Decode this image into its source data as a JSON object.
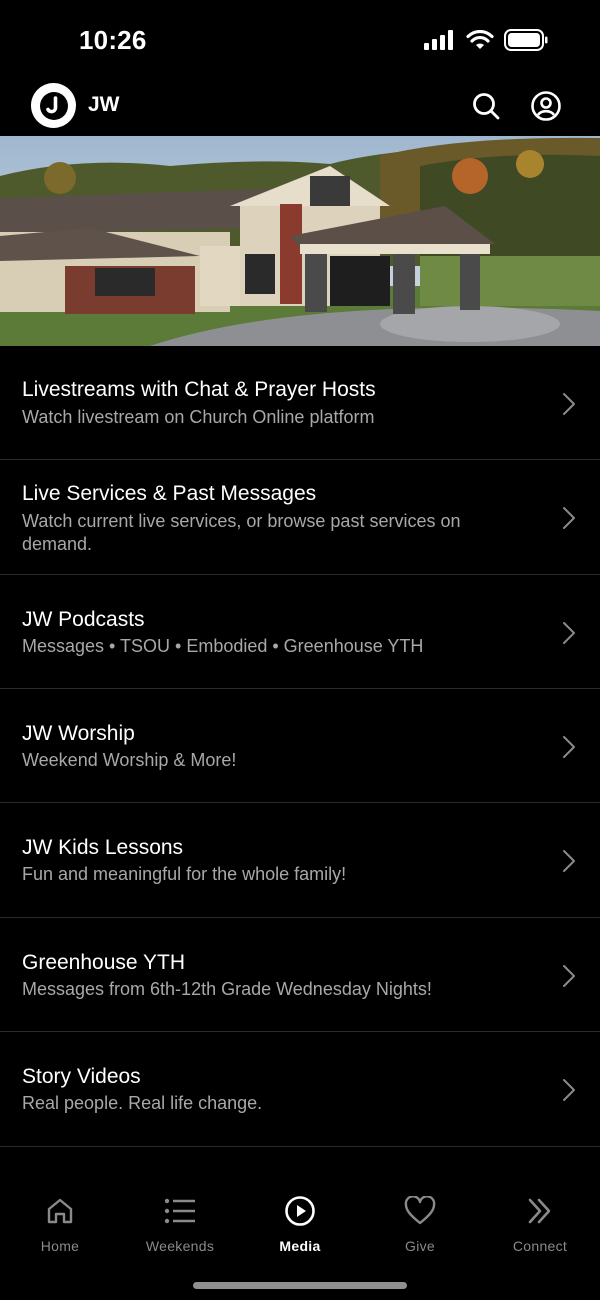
{
  "status_bar": {
    "time": "10:26"
  },
  "header": {
    "logo_letter": "J",
    "brand": "JW"
  },
  "hero": {
    "alt": ""
  },
  "media_items": [
    {
      "title": "Livestreams with Chat & Prayer Hosts",
      "subtitle": "Watch livestream on Church Online platform"
    },
    {
      "title": "Live Services & Past Messages",
      "subtitle": "Watch current live services, or browse past services on demand."
    },
    {
      "title": "JW Podcasts",
      "subtitle": "Messages • TSOU • Embodied • Greenhouse YTH"
    },
    {
      "title": "JW Worship",
      "subtitle": "Weekend Worship & More!"
    },
    {
      "title": "JW Kids Lessons",
      "subtitle": "Fun and meaningful for the whole family!"
    },
    {
      "title": "Greenhouse YTH",
      "subtitle": "Messages from 6th-12th Grade Wednesday Nights!"
    },
    {
      "title": "Story Videos",
      "subtitle": "Real people. Real life change."
    }
  ],
  "tabs": [
    {
      "label": "Home",
      "icon": "home-icon"
    },
    {
      "label": "Weekends",
      "icon": "list-icon"
    },
    {
      "label": "Media",
      "icon": "play-circle-icon",
      "active": true
    },
    {
      "label": "Give",
      "icon": "heart-icon"
    },
    {
      "label": "Connect",
      "icon": "double-chevron-icon"
    }
  ],
  "colors": {
    "background": "#000000",
    "text": "#ffffff",
    "subtext": "#a8a8a8",
    "divider": "#2a2a2a",
    "inactive_tab": "#8a8a8a"
  }
}
